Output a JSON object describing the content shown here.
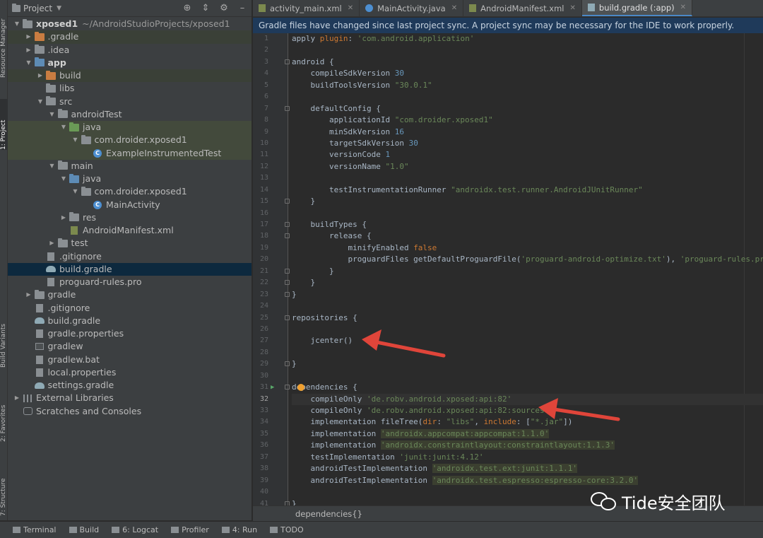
{
  "left_strip": {
    "labels": [
      "Resource Manager",
      "1: Project",
      "Build Variants",
      "2: Favorites",
      "7: Structure"
    ]
  },
  "project_panel": {
    "title": "Project",
    "tree": [
      {
        "indent": 0,
        "arrow": "down",
        "icon": "folder",
        "label": "xposed1",
        "bold": true,
        "extra": "~/AndroidStudioProjects/xposed1"
      },
      {
        "indent": 1,
        "arrow": "right",
        "icon": "folder-orange",
        "label": ".gradle",
        "hl": "hl"
      },
      {
        "indent": 1,
        "arrow": "right",
        "icon": "folder",
        "label": ".idea"
      },
      {
        "indent": 1,
        "arrow": "down",
        "icon": "folder-blue",
        "label": "app",
        "bold": true
      },
      {
        "indent": 2,
        "arrow": "right",
        "icon": "folder-orange",
        "label": "build",
        "hl": "hl"
      },
      {
        "indent": 2,
        "arrow": "none",
        "icon": "folder",
        "label": "libs"
      },
      {
        "indent": 2,
        "arrow": "down",
        "icon": "folder",
        "label": "src"
      },
      {
        "indent": 3,
        "arrow": "down",
        "icon": "folder",
        "label": "androidTest"
      },
      {
        "indent": 4,
        "arrow": "down",
        "icon": "folder-green",
        "label": "java",
        "hl": "hl2"
      },
      {
        "indent": 5,
        "arrow": "down",
        "icon": "folder",
        "label": "com.droider.xposed1",
        "hl": "hl2"
      },
      {
        "indent": 6,
        "arrow": "none",
        "icon": "class",
        "label": "ExampleInstrumentedTest",
        "hl": "hl2"
      },
      {
        "indent": 3,
        "arrow": "down",
        "icon": "folder",
        "label": "main"
      },
      {
        "indent": 4,
        "arrow": "down",
        "icon": "folder-blue",
        "label": "java"
      },
      {
        "indent": 5,
        "arrow": "down",
        "icon": "folder",
        "label": "com.droider.xposed1"
      },
      {
        "indent": 6,
        "arrow": "none",
        "icon": "class",
        "label": "MainActivity"
      },
      {
        "indent": 4,
        "arrow": "right",
        "icon": "folder",
        "label": "res"
      },
      {
        "indent": 4,
        "arrow": "none",
        "icon": "file-xml",
        "label": "AndroidManifest.xml"
      },
      {
        "indent": 3,
        "arrow": "right",
        "icon": "folder",
        "label": "test"
      },
      {
        "indent": 2,
        "arrow": "none",
        "icon": "file",
        "label": ".gitignore"
      },
      {
        "indent": 2,
        "arrow": "none",
        "icon": "gradle",
        "label": "build.gradle",
        "hl": "sel"
      },
      {
        "indent": 2,
        "arrow": "none",
        "icon": "file",
        "label": "proguard-rules.pro"
      },
      {
        "indent": 1,
        "arrow": "right",
        "icon": "folder",
        "label": "gradle"
      },
      {
        "indent": 1,
        "arrow": "none",
        "icon": "file",
        "label": ".gitignore"
      },
      {
        "indent": 1,
        "arrow": "none",
        "icon": "gradle",
        "label": "build.gradle"
      },
      {
        "indent": 1,
        "arrow": "none",
        "icon": "file",
        "label": "gradle.properties"
      },
      {
        "indent": 1,
        "arrow": "none",
        "icon": "terminal",
        "label": "gradlew"
      },
      {
        "indent": 1,
        "arrow": "none",
        "icon": "file",
        "label": "gradlew.bat"
      },
      {
        "indent": 1,
        "arrow": "none",
        "icon": "file",
        "label": "local.properties"
      },
      {
        "indent": 1,
        "arrow": "none",
        "icon": "gradle",
        "label": "settings.gradle"
      },
      {
        "indent": 0,
        "arrow": "right",
        "icon": "library",
        "label": "External Libraries"
      },
      {
        "indent": 0,
        "arrow": "none",
        "icon": "scratch",
        "label": "Scratches and Consoles"
      }
    ]
  },
  "tabs": [
    {
      "label": "activity_main.xml",
      "icon": "xml",
      "active": false
    },
    {
      "label": "MainActivity.java",
      "icon": "class",
      "active": false
    },
    {
      "label": "AndroidManifest.xml",
      "icon": "xml",
      "active": false
    },
    {
      "label": "build.gradle (:app)",
      "icon": "gradle",
      "active": true
    }
  ],
  "banner": {
    "text": "Gradle files have changed since last project sync. A project sync may be necessary for the IDE to work properly."
  },
  "editor": {
    "current_line": 32,
    "lines": [
      {
        "n": "1",
        "tokens": [
          [
            "t",
            "apply "
          ],
          [
            "k",
            "plugin"
          ],
          [
            "t",
            ": "
          ],
          [
            "s",
            "'com.android.application'"
          ]
        ]
      },
      {
        "n": "2",
        "tokens": []
      },
      {
        "n": "3",
        "fold": true,
        "tokens": [
          [
            "t",
            "android {"
          ]
        ]
      },
      {
        "n": "4",
        "tokens": [
          [
            "t",
            "    compileSdkVersion "
          ],
          [
            "n",
            "30"
          ]
        ]
      },
      {
        "n": "5",
        "tokens": [
          [
            "t",
            "    buildToolsVersion "
          ],
          [
            "s",
            "\"30.0.1\""
          ]
        ]
      },
      {
        "n": "6",
        "tokens": []
      },
      {
        "n": "7",
        "fold": true,
        "tokens": [
          [
            "t",
            "    defaultConfig {"
          ]
        ]
      },
      {
        "n": "8",
        "tokens": [
          [
            "t",
            "        applicationId "
          ],
          [
            "s",
            "\"com.droider.xposed1\""
          ]
        ]
      },
      {
        "n": "9",
        "tokens": [
          [
            "t",
            "        minSdkVersion "
          ],
          [
            "n",
            "16"
          ]
        ]
      },
      {
        "n": "10",
        "tokens": [
          [
            "t",
            "        targetSdkVersion "
          ],
          [
            "n",
            "30"
          ]
        ]
      },
      {
        "n": "11",
        "tokens": [
          [
            "t",
            "        versionCode "
          ],
          [
            "n",
            "1"
          ]
        ]
      },
      {
        "n": "12",
        "tokens": [
          [
            "t",
            "        versionName "
          ],
          [
            "s",
            "\"1.0\""
          ]
        ]
      },
      {
        "n": "13",
        "tokens": []
      },
      {
        "n": "14",
        "tokens": [
          [
            "t",
            "        testInstrumentationRunner "
          ],
          [
            "s",
            "\"androidx.test.runner.AndroidJUnitRunner\""
          ]
        ]
      },
      {
        "n": "15",
        "fold": true,
        "tokens": [
          [
            "t",
            "    }"
          ]
        ]
      },
      {
        "n": "16",
        "tokens": []
      },
      {
        "n": "17",
        "fold": true,
        "tokens": [
          [
            "t",
            "    buildTypes {"
          ]
        ]
      },
      {
        "n": "18",
        "fold": true,
        "tokens": [
          [
            "t",
            "        release {"
          ]
        ]
      },
      {
        "n": "19",
        "tokens": [
          [
            "t",
            "            minifyEnabled "
          ],
          [
            "k",
            "false"
          ]
        ]
      },
      {
        "n": "20",
        "tokens": [
          [
            "t",
            "            proguardFiles getDefaultProguardFile("
          ],
          [
            "s",
            "'proguard-android-optimize.txt'"
          ],
          [
            "t",
            "), "
          ],
          [
            "s",
            "'proguard-rules.pro'"
          ]
        ]
      },
      {
        "n": "21",
        "fold": true,
        "tokens": [
          [
            "t",
            "        }"
          ]
        ]
      },
      {
        "n": "22",
        "fold": true,
        "tokens": [
          [
            "t",
            "    }"
          ]
        ]
      },
      {
        "n": "23",
        "fold": true,
        "tokens": [
          [
            "t",
            "}"
          ]
        ]
      },
      {
        "n": "24",
        "tokens": []
      },
      {
        "n": "25",
        "fold": true,
        "tokens": [
          [
            "t",
            "repositories {"
          ]
        ]
      },
      {
        "n": "26",
        "tokens": []
      },
      {
        "n": "27",
        "tokens": [
          [
            "t",
            "    jcenter()"
          ]
        ]
      },
      {
        "n": "28",
        "tokens": []
      },
      {
        "n": "29",
        "fold": true,
        "tokens": [
          [
            "t",
            "}"
          ]
        ]
      },
      {
        "n": "30",
        "tokens": []
      },
      {
        "n": "31",
        "fold": true,
        "run": true,
        "bulb": true,
        "tokens": [
          [
            "t",
            "dependencies {"
          ]
        ]
      },
      {
        "n": "32",
        "tokens": [
          [
            "t",
            "    compileOnly "
          ],
          [
            "s",
            "'de.robv.android.xposed:api:82'"
          ]
        ]
      },
      {
        "n": "33",
        "tokens": [
          [
            "t",
            "    compileOnly "
          ],
          [
            "s",
            "'de.robv.android.xposed:api:82:sources'"
          ]
        ]
      },
      {
        "n": "34",
        "tokens": [
          [
            "t",
            "    implementation fileTree("
          ],
          [
            "k",
            "dir"
          ],
          [
            "t",
            ": "
          ],
          [
            "s",
            "\"libs\""
          ],
          [
            "t",
            ", "
          ],
          [
            "k",
            "include"
          ],
          [
            "t",
            ": ["
          ],
          [
            "s",
            "\"*.jar\""
          ],
          [
            "t",
            "])"
          ]
        ]
      },
      {
        "n": "35",
        "tokens": [
          [
            "t",
            "    implementation "
          ],
          [
            "h",
            "'androidx.appcompat:appcompat:1.1.0'"
          ]
        ]
      },
      {
        "n": "36",
        "tokens": [
          [
            "t",
            "    implementation "
          ],
          [
            "h",
            "'androidx.constraintlayout:constraintlayout:1.1.3'"
          ]
        ]
      },
      {
        "n": "37",
        "tokens": [
          [
            "t",
            "    testImplementation "
          ],
          [
            "s",
            "'junit:junit:4.12'"
          ]
        ]
      },
      {
        "n": "38",
        "tokens": [
          [
            "t",
            "    androidTestImplementation "
          ],
          [
            "h",
            "'androidx.test.ext:junit:1.1.1'"
          ]
        ]
      },
      {
        "n": "39",
        "tokens": [
          [
            "t",
            "    androidTestImplementation "
          ],
          [
            "h",
            "'androidx.test.espresso:espresso-core:3.2.0'"
          ]
        ]
      },
      {
        "n": "40",
        "tokens": []
      },
      {
        "n": "41",
        "fold": true,
        "tokens": [
          [
            "t",
            "}"
          ]
        ]
      }
    ]
  },
  "breadcrumb": "dependencies{}",
  "bottom_bar": [
    {
      "label": "Terminal",
      "icon": "terminal-icon"
    },
    {
      "label": "Build",
      "icon": "hammer-icon"
    },
    {
      "label": "6: Logcat",
      "icon": "logcat-icon"
    },
    {
      "label": "Profiler",
      "icon": "profiler-icon"
    },
    {
      "label": "4: Run",
      "icon": "play-icon"
    },
    {
      "label": "TODO",
      "icon": "list-icon"
    }
  ],
  "watermark": {
    "text": "Tide安全团队"
  },
  "colors": {
    "accent": "#4a88c7",
    "banner_bg": "#1f3a5a",
    "arrow": "#e0453a",
    "string": "#6a8759",
    "number": "#6897bb",
    "keyword": "#cc7832"
  }
}
